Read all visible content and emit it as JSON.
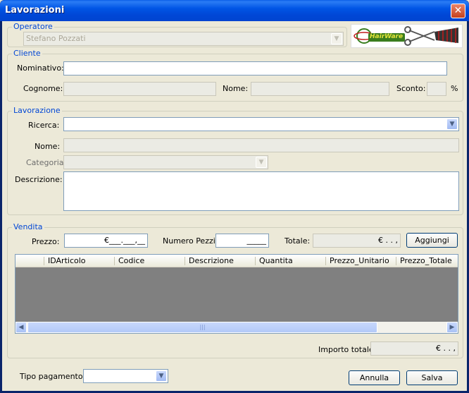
{
  "window": {
    "title": "Lavorazioni",
    "close": "✕"
  },
  "operatore": {
    "legend": "Operatore",
    "value": "Stefano Pozzati"
  },
  "logo": {
    "text": "HairWare"
  },
  "cliente": {
    "legend": "Cliente",
    "nominativo_label": "Nominativo:",
    "nominativo_value": "",
    "cognome_label": "Cognome:",
    "cognome_value": "",
    "nome_label": "Nome:",
    "nome_value": "",
    "sconto_label": "Sconto:",
    "sconto_value": "",
    "percent": "%"
  },
  "lavorazione": {
    "legend": "Lavorazione",
    "ricerca_label": "Ricerca:",
    "ricerca_value": "",
    "nome_label": "Nome:",
    "nome_value": "",
    "categoria_label": "Categoria:",
    "categoria_value": "",
    "descrizione_label": "Descrizione:",
    "descrizione_value": ""
  },
  "vendita": {
    "legend": "Vendita",
    "prezzo_label": "Prezzo:",
    "prezzo_value": "€___.___,__",
    "pezzi_label": "Numero Pezzi:",
    "pezzi_value": "_____",
    "totale_label": "Totale:",
    "totale_value": "€   .   .   ,",
    "aggiungi": "Aggiungi",
    "columns": [
      "IDArticolo",
      "Codice",
      "Descrizione",
      "Quantita",
      "Prezzo_Unitario",
      "Prezzo_Totale"
    ],
    "importo_label": "Importo totale:",
    "importo_value": "€   .   .   ,"
  },
  "footer": {
    "tipo_label": "Tipo pagamento:",
    "tipo_value": "",
    "annulla": "Annulla",
    "salva": "Salva"
  }
}
